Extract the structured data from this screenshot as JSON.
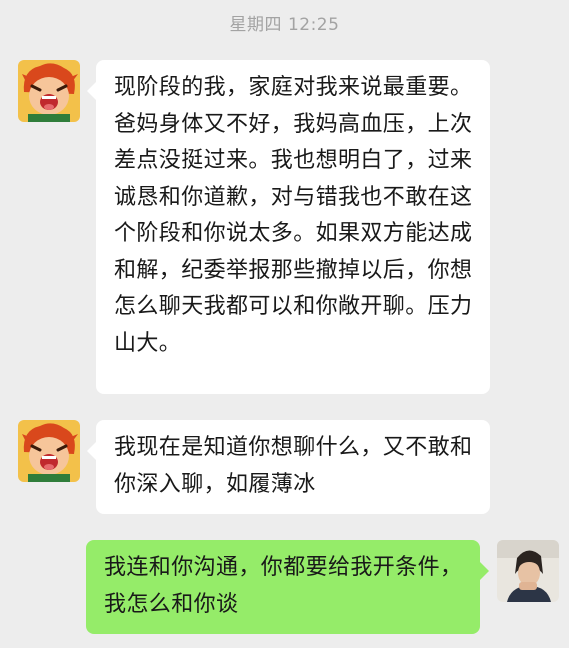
{
  "chat": {
    "timestamp": "星期四 12:25",
    "messages": [
      {
        "sender": "contact",
        "text": "现阶段的我，家庭对我来说最重要。爸妈身体又不好，我妈高血压，上次差点没挺过来。我也想明白了，过来诚恳和你道歉，对与错我也不敢在这个阶段和你说太多。如果双方能达成和解，纪委举报那些撤掉以后，你想怎么聊天我都可以和你敞开聊。压力山大。"
      },
      {
        "sender": "contact",
        "text": "我现在是知道你想聊什么，又不敢和你深入聊，如履薄冰"
      },
      {
        "sender": "me",
        "text": "我连和你沟通，你都要给我开条件，我怎么和你谈"
      }
    ]
  },
  "colors": {
    "background": "#ededed",
    "incoming_bubble": "#ffffff",
    "outgoing_bubble": "#95ec69",
    "timestamp_text": "#a3a3a3"
  },
  "icons": {
    "contact_avatar": "cartoon-boy-avatar-icon",
    "user_avatar": "user-photo-avatar"
  }
}
